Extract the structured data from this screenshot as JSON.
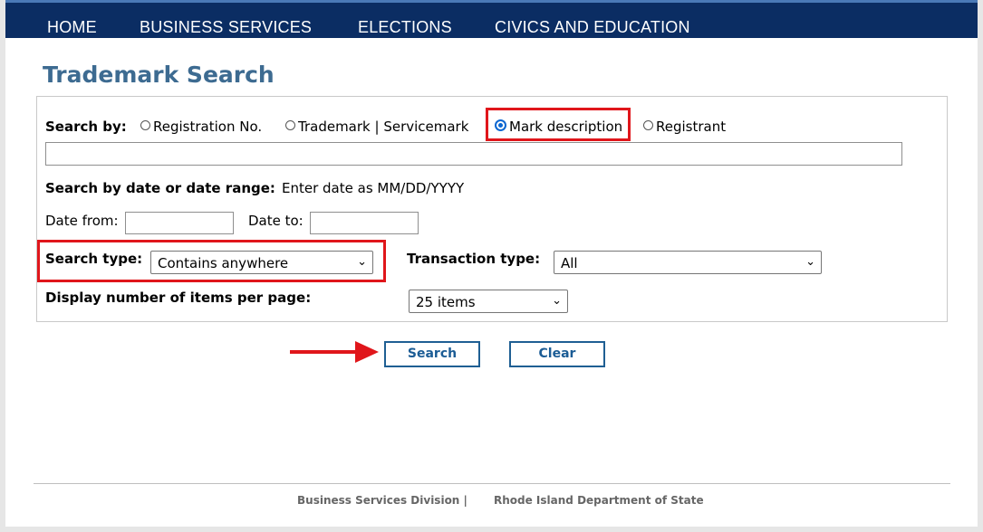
{
  "nav": {
    "items": [
      {
        "label": "HOME"
      },
      {
        "label": "BUSINESS SERVICES"
      },
      {
        "label": "ELECTIONS"
      },
      {
        "label": "CIVICS AND EDUCATION"
      }
    ]
  },
  "page": {
    "title": "Trademark Search"
  },
  "search_by": {
    "label": "Search by:",
    "options": [
      {
        "label": "Registration No.",
        "selected": false
      },
      {
        "label": "Trademark | Servicemark",
        "selected": false
      },
      {
        "label": "Mark description",
        "selected": true
      },
      {
        "label": "Registrant",
        "selected": false
      }
    ],
    "input_value": ""
  },
  "date": {
    "heading": "Search by date or date range:",
    "hint": "Enter date as MM/DD/YYYY",
    "from_label": "Date from:",
    "from_value": "",
    "to_label": "Date to:",
    "to_value": ""
  },
  "search_type": {
    "label": "Search type:",
    "value": "Contains anywhere"
  },
  "transaction_type": {
    "label": "Transaction type:",
    "value": "All"
  },
  "per_page": {
    "label": "Display number of items per page:",
    "value": "25 items"
  },
  "buttons": {
    "search": "Search",
    "clear": "Clear"
  },
  "footer": {
    "division": "Business Services Division |",
    "department": "Rhode Island Department of State"
  },
  "annotation_color": "#e0161b"
}
